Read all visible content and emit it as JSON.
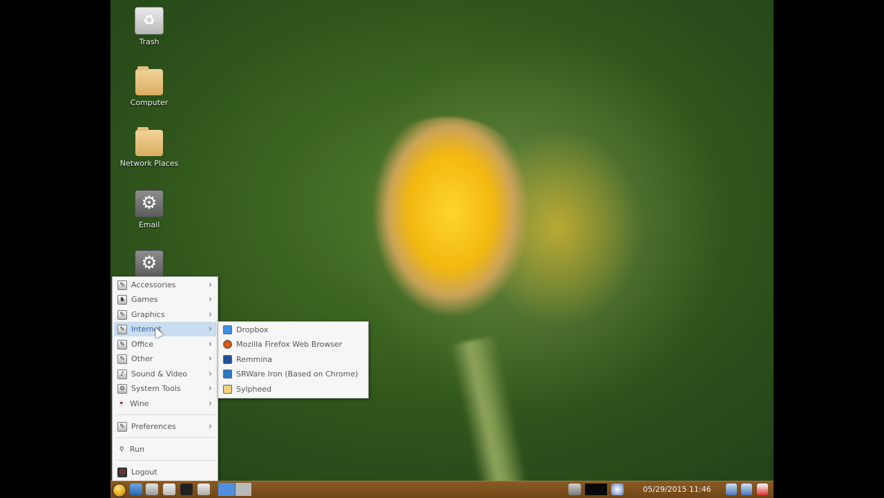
{
  "desktop": {
    "icons": [
      {
        "label": "Trash",
        "icon": "trash-icon"
      },
      {
        "label": "Computer",
        "icon": "folder-icon"
      },
      {
        "label": "Network Places",
        "icon": "folder-icon"
      },
      {
        "label": "Email",
        "icon": "gear-icon"
      },
      {
        "label": "",
        "icon": "gear-icon"
      }
    ]
  },
  "main_menu": {
    "items": [
      {
        "label": "Accessories",
        "icon": "accessories-icon"
      },
      {
        "label": "Games",
        "icon": "games-icon"
      },
      {
        "label": "Graphics",
        "icon": "graphics-icon"
      },
      {
        "label": "Internet",
        "icon": "internet-icon",
        "active": true
      },
      {
        "label": "Office",
        "icon": "office-icon"
      },
      {
        "label": "Other",
        "icon": "other-icon"
      },
      {
        "label": "Sound & Video",
        "icon": "sound-video-icon"
      },
      {
        "label": "System Tools",
        "icon": "system-tools-icon"
      },
      {
        "label": "Wine",
        "icon": "wine-icon"
      },
      {
        "label": "Preferences",
        "icon": "preferences-icon"
      },
      {
        "label": "Run",
        "icon": "run-icon"
      },
      {
        "label": "Logout",
        "icon": "logout-icon"
      }
    ]
  },
  "internet_submenu": {
    "items": [
      {
        "label": "Dropbox",
        "icon": "dropbox-icon"
      },
      {
        "label": "Mozilla Firefox Web Browser",
        "icon": "firefox-icon"
      },
      {
        "label": "Remmina",
        "icon": "remmina-icon"
      },
      {
        "label": "SRWare Iron (Based on Chrome)",
        "icon": "iron-icon"
      },
      {
        "label": "Sylpheed",
        "icon": "sylpheed-icon"
      }
    ]
  },
  "taskbar": {
    "clock": "05/29/2015 11:46",
    "colors": {
      "bar": "#7a4f1c",
      "workspace_active": "#4f8fe0",
      "workspace_inactive": "#b9b9b9"
    }
  }
}
